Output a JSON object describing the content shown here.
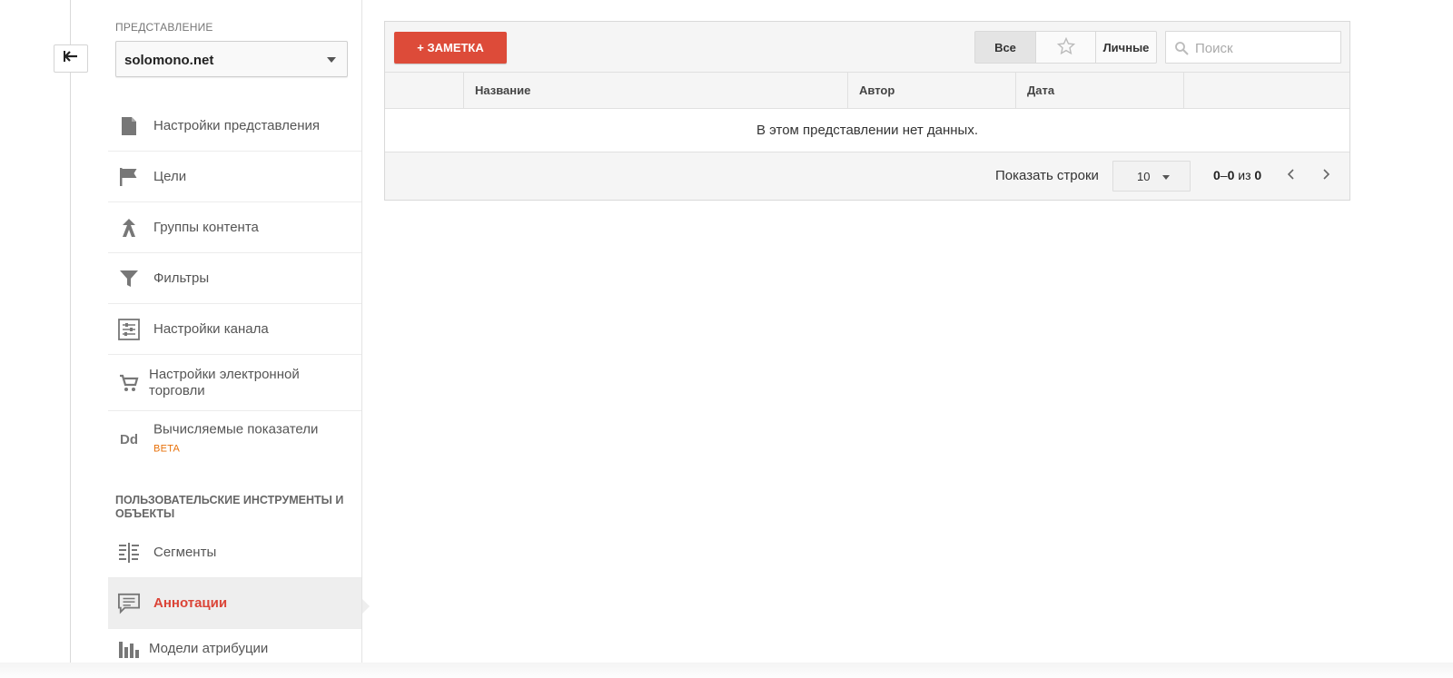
{
  "sidebar": {
    "view_label": "ПРЕДСТАВЛЕНИЕ",
    "view_value": "solomono.net",
    "items": [
      {
        "label": "Настройки представления",
        "icon": "document-icon"
      },
      {
        "label": "Цели",
        "icon": "flag-icon"
      },
      {
        "label": "Группы контента",
        "icon": "content-group-icon"
      },
      {
        "label": "Фильтры",
        "icon": "filter-icon"
      },
      {
        "label": "Настройки канала",
        "icon": "channel-settings-icon"
      },
      {
        "label": "Настройки электронной торговли",
        "icon": "cart-icon"
      },
      {
        "label": "Вычисляемые показатели",
        "badge": "BETA",
        "icon_text": "Dd"
      }
    ],
    "section_title": "ПОЛЬЗОВАТЕЛЬСКИЕ ИНСТРУМЕНТЫ И ОБЪЕКТЫ",
    "tools": [
      {
        "label": "Сегменты",
        "icon": "segments-icon"
      },
      {
        "label": "Аннотации",
        "icon": "annotation-icon",
        "active": true
      },
      {
        "label": "Модели атрибуции",
        "icon": "bar-chart-icon"
      }
    ]
  },
  "toolbar": {
    "add_note_label": "+ ЗАМЕТКА",
    "filter_all": "Все",
    "filter_personal": "Личные",
    "search_placeholder": "Поиск"
  },
  "table": {
    "columns": [
      "",
      "Название",
      "Автор",
      "Дата",
      ""
    ],
    "empty_message": "В этом представлении нет данных.",
    "rows": []
  },
  "pagination": {
    "rows_label": "Показать строки",
    "rows_value": "10",
    "range_start": "0",
    "range_end": "0",
    "range_of": "из",
    "total": "0"
  },
  "colors": {
    "accent_red": "#dd4b39",
    "active_text": "#db4437",
    "beta_orange": "#e8710a"
  }
}
